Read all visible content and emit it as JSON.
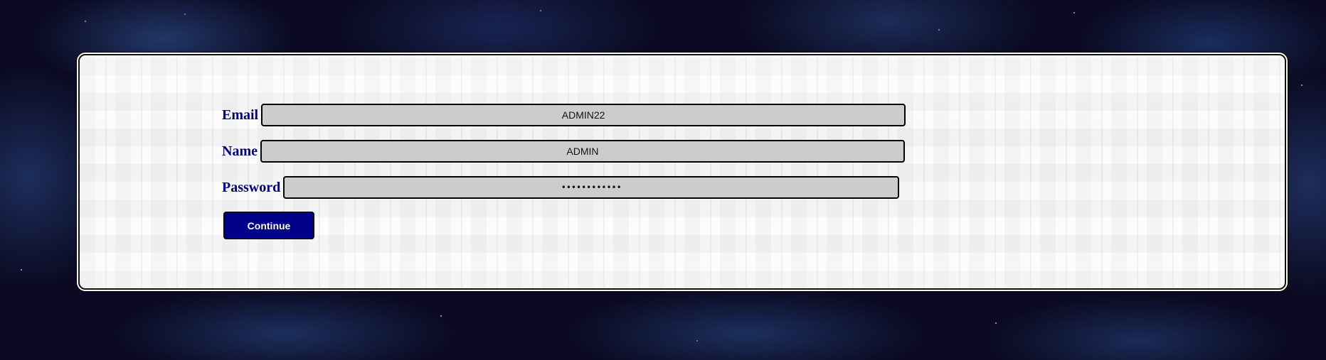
{
  "form": {
    "email": {
      "label": "Email",
      "value": "ADMIN22"
    },
    "name": {
      "label": "Name",
      "value": "ADMIN"
    },
    "password": {
      "label": "Password",
      "value": "••••••••••••"
    },
    "continue_label": "Continue"
  },
  "colors": {
    "label_text": "#00007a",
    "button_background": "#000088",
    "input_background": "#cccccc"
  }
}
